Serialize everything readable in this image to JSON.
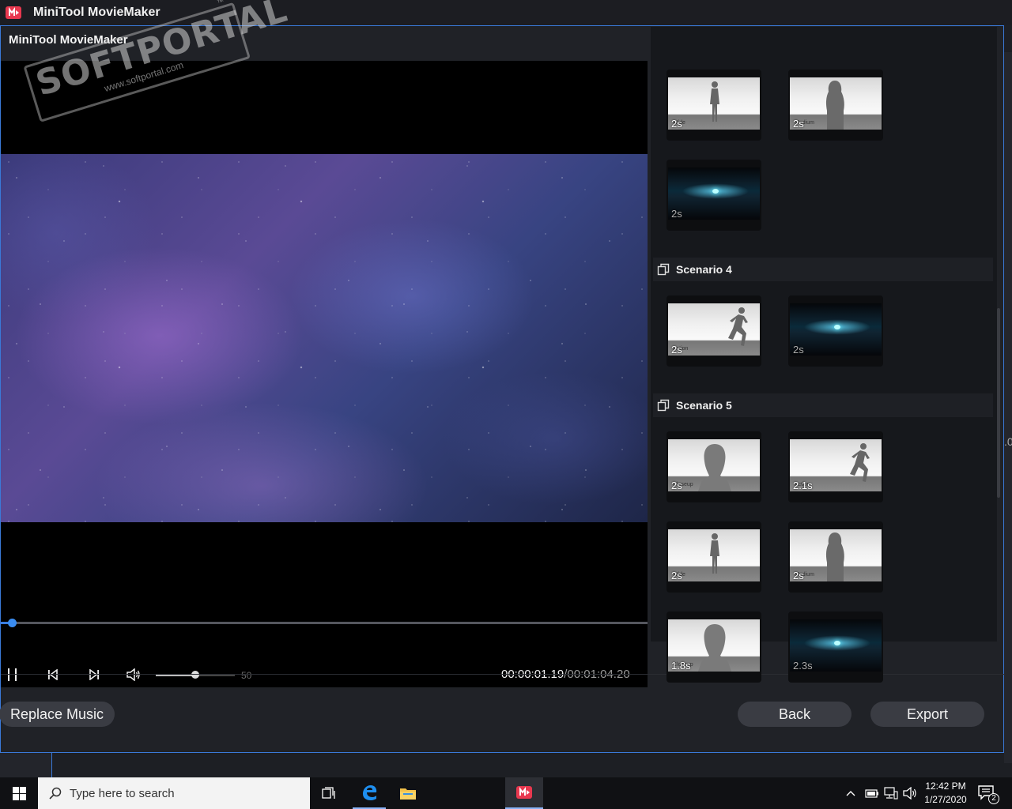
{
  "app": {
    "window_title": "MiniTool MovieMaker"
  },
  "dialog": {
    "title": "MiniTool MovieMaker",
    "close_glyph": "✕"
  },
  "watermark": {
    "brand": "SOFTPORTAL",
    "url": "www.softportal.com",
    "tm": "™"
  },
  "player": {
    "time_current": "00:00:01.19",
    "time_total": "/00:01:04.20",
    "volume": "50",
    "progress_fraction": 0.017
  },
  "panel": {
    "rows_before": [
      {
        "thumbs": [
          {
            "style": "light",
            "figure": "standing",
            "kind": "Wide",
            "duration": "2s"
          },
          {
            "style": "light",
            "figure": "medium",
            "kind": "Medium",
            "duration": "2s"
          }
        ]
      },
      {
        "thumbs": [
          {
            "style": "dark",
            "figure": "none",
            "kind": "",
            "duration": "2s"
          }
        ]
      }
    ],
    "scenario4": {
      "label": "Scenario 4",
      "thumbs": [
        {
          "style": "light",
          "figure": "runner",
          "kind": "Action",
          "duration": "2s"
        },
        {
          "style": "dark",
          "figure": "none",
          "kind": "",
          "duration": "2s"
        }
      ]
    },
    "scenario5": {
      "label": "Scenario 5",
      "row1": [
        {
          "style": "light",
          "figure": "head",
          "kind": "Closeup",
          "duration": "2s"
        },
        {
          "style": "light",
          "figure": "runner",
          "kind": "Action",
          "duration": "2.1s"
        }
      ],
      "row2": [
        {
          "style": "light",
          "figure": "standing",
          "kind": "Wide",
          "duration": "2s"
        },
        {
          "style": "light",
          "figure": "medium",
          "kind": "Medium",
          "duration": "2s"
        }
      ],
      "row3": [
        {
          "style": "light",
          "figure": "head",
          "kind": "Closeup",
          "duration": "1.8s"
        },
        {
          "style": "dark",
          "figure": "none",
          "kind": "",
          "duration": "2.3s"
        }
      ]
    }
  },
  "buttons": {
    "replace_music": "Replace Music",
    "back": "Back",
    "export": "Export"
  },
  "taskbar": {
    "search_placeholder": "Type here to search",
    "time": "12:42 PM",
    "date": "1/27/2020",
    "notification_count": "2"
  },
  "colors": {
    "accent": "#3a7de0",
    "brand_red": "#e8384f",
    "dialog_border": "#3a79d8"
  }
}
